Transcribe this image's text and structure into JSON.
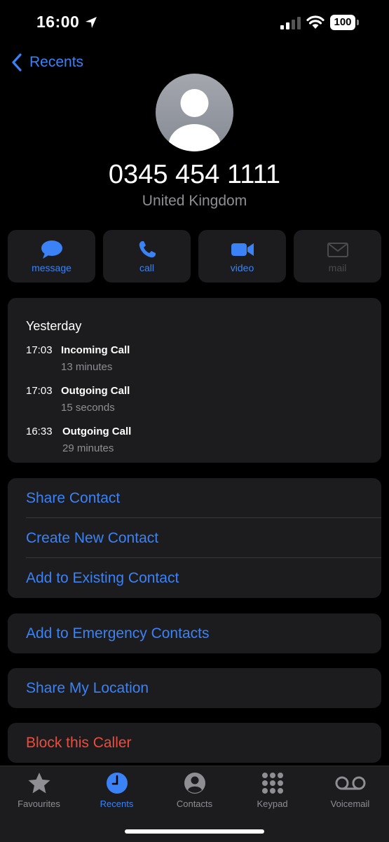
{
  "status_bar": {
    "time": "16:00",
    "battery": "100"
  },
  "nav": {
    "back_label": "Recents"
  },
  "contact": {
    "number": "0345 454 1111",
    "country": "United Kingdom"
  },
  "actions": [
    {
      "label": "message",
      "icon": "message-bubble-icon"
    },
    {
      "label": "call",
      "icon": "phone-icon"
    },
    {
      "label": "video",
      "icon": "video-camera-icon"
    },
    {
      "label": "mail",
      "icon": "envelope-icon",
      "enabled": false
    }
  ],
  "history": {
    "date": "Yesterday",
    "entries": [
      {
        "time": "17:03",
        "type": "Incoming Call",
        "duration": "13 minutes"
      },
      {
        "time": "17:03",
        "type": "Outgoing Call",
        "duration": "15 seconds"
      },
      {
        "time": "16:33",
        "type": "Outgoing Call",
        "duration": "29 minutes"
      }
    ]
  },
  "contact_options": [
    "Share Contact",
    "Create New Contact",
    "Add to Existing Contact"
  ],
  "emergency": "Add to Emergency Contacts",
  "share_location": "Share My Location",
  "block": "Block this Caller",
  "tabs": [
    {
      "label": "Favourites",
      "icon": "star-icon"
    },
    {
      "label": "Recents",
      "icon": "clock-icon",
      "active": true
    },
    {
      "label": "Contacts",
      "icon": "person-circle-icon"
    },
    {
      "label": "Keypad",
      "icon": "keypad-grid-icon"
    },
    {
      "label": "Voicemail",
      "icon": "voicemail-icon"
    }
  ],
  "colors": {
    "accent": "#3a82f6",
    "destructive": "#eb4d3d",
    "card": "#1c1c1e",
    "background": "#000000"
  }
}
